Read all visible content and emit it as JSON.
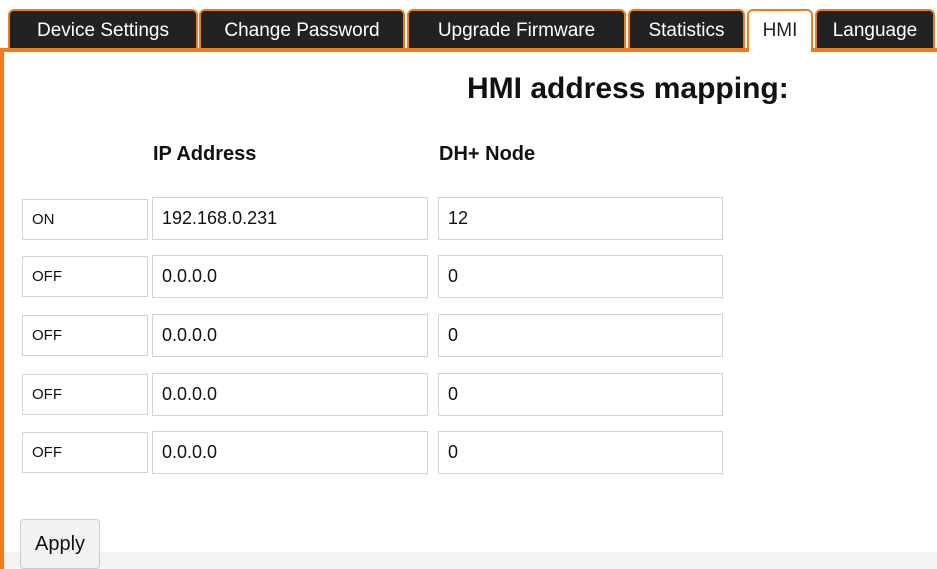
{
  "tabs": [
    {
      "label": "Device Settings",
      "active": false
    },
    {
      "label": "Change Password",
      "active": false
    },
    {
      "label": "Upgrade Firmware",
      "active": false
    },
    {
      "label": "Statistics",
      "active": false
    },
    {
      "label": "HMI",
      "active": true
    },
    {
      "label": "Language",
      "active": false
    }
  ],
  "page": {
    "title": "HMI address mapping:",
    "ip_header": "IP Address",
    "node_header": "DH+ Node"
  },
  "rows": [
    {
      "status": "ON",
      "ip": "192.168.0.231",
      "node": "12"
    },
    {
      "status": "OFF",
      "ip": "0.0.0.0",
      "node": "0"
    },
    {
      "status": "OFF",
      "ip": "0.0.0.0",
      "node": "0"
    },
    {
      "status": "OFF",
      "ip": "0.0.0.0",
      "node": "0"
    },
    {
      "status": "OFF",
      "ip": "0.0.0.0",
      "node": "0"
    }
  ],
  "actions": {
    "apply_label": "Apply"
  },
  "colors": {
    "accent": "#f07c1e",
    "tab_bg": "#222222",
    "tab_text": "#ffffff"
  }
}
